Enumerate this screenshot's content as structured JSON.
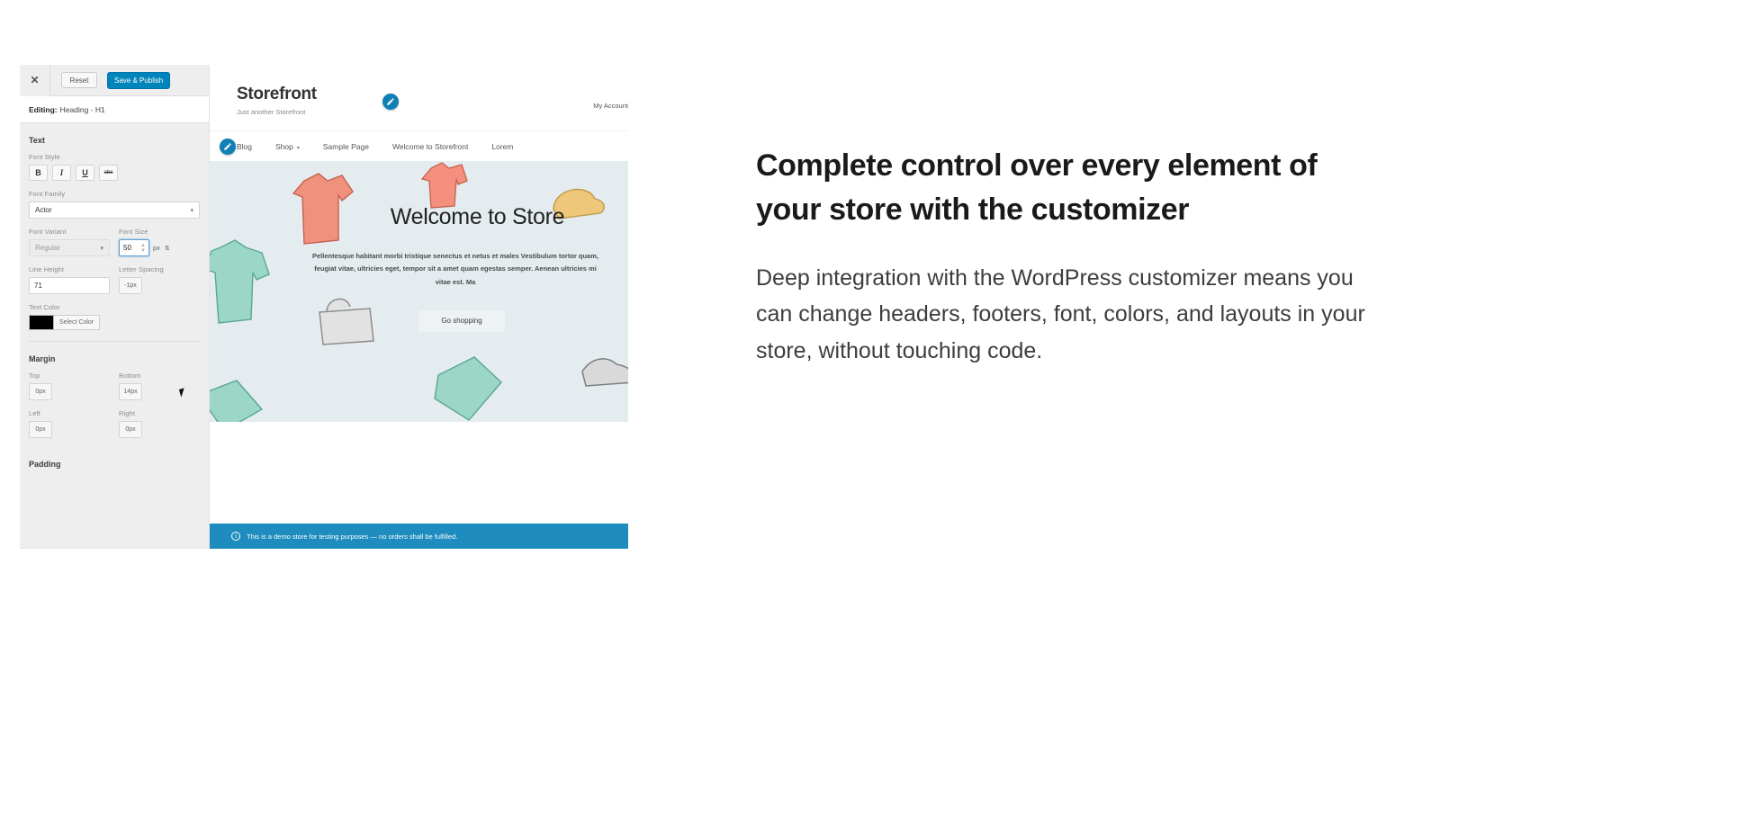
{
  "customizer": {
    "close_icon": "close-icon",
    "reset_label": "Reset",
    "save_label": "Save & Publish",
    "editing_prefix": "Editing:",
    "editing_target": "Heading - H1",
    "sections": {
      "text": {
        "title": "Text",
        "font_style_label": "Font Style",
        "style_buttons": [
          {
            "name": "bold",
            "glyph": "B"
          },
          {
            "name": "italic",
            "glyph": "I"
          },
          {
            "name": "underline",
            "glyph": "U"
          },
          {
            "name": "strikethrough",
            "glyph": "abc"
          }
        ],
        "font_family_label": "Font Family",
        "font_family_value": "Actor",
        "font_variant_label": "Font Variant",
        "font_variant_value": "Regular",
        "font_size_label": "Font Size",
        "font_size_value": "50",
        "font_size_unit": "px",
        "line_height_label": "Line Height",
        "line_height_value": "71",
        "letter_spacing_label": "Letter Spacing",
        "letter_spacing_value": "-1px",
        "text_color_label": "Text Color",
        "text_color_value": "#000000",
        "select_color_label": "Select Color"
      },
      "margin": {
        "title": "Margin",
        "top_label": "Top",
        "top_value": "0px",
        "bottom_label": "Bottom",
        "bottom_value": "14px",
        "left_label": "Left",
        "left_value": "0px",
        "right_label": "Right",
        "right_value": "0px"
      },
      "padding": {
        "title": "Padding"
      }
    },
    "accent_color": "#0085ba"
  },
  "preview": {
    "site_title": "Storefront",
    "tagline": "Just another Storefront",
    "account_links": [
      "My Account"
    ],
    "nav": [
      {
        "label": "Blog",
        "has_dropdown": false
      },
      {
        "label": "Shop",
        "has_dropdown": true
      },
      {
        "label": "Sample Page",
        "has_dropdown": false
      },
      {
        "label": "Welcome to Storefront",
        "has_dropdown": false
      },
      {
        "label": "Lorem",
        "has_dropdown": false
      }
    ],
    "hero": {
      "heading": "Welcome to Store",
      "paragraph": "Pellentesque habitant morbi tristique senectus et netus et males Vestibulum tortor quam, feugiat vitae, ultricies eget, tempor sit a amet quam egestas semper. Aenean ultricies mi vitae est. Ma",
      "button_label": "Go shopping"
    },
    "notice": "This is a demo store for testing purposes — no orders shall be fulfilled."
  },
  "marketing": {
    "heading": "Complete control over every element of your store with the customizer",
    "body": "Deep integration with the WordPress customizer means you can change headers, footers, font, colors, and layouts in your store, without touching code."
  }
}
